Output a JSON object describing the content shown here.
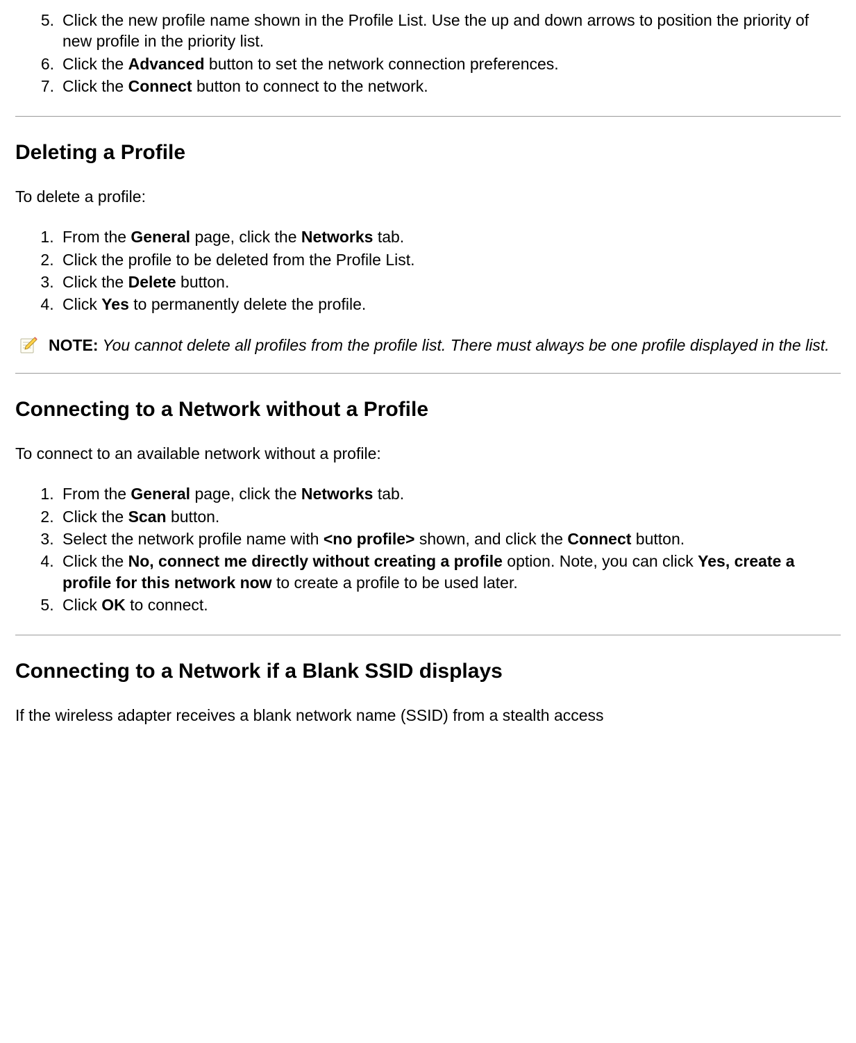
{
  "topList": {
    "items": [
      {
        "num": "5.",
        "text_a": "Click the new profile name shown in the Profile List. Use the up and down arrows to position the priority of new profile in the priority list."
      },
      {
        "num": "6.",
        "text_a": "Click the ",
        "bold_a": "Advanced",
        "text_b": " button to set the network connection preferences."
      },
      {
        "num": "7.",
        "text_a": "Click the ",
        "bold_a": "Connect",
        "text_b": " button to connect to the network."
      }
    ]
  },
  "sectionDelete": {
    "heading": "Deleting a Profile",
    "intro": "To delete a profile:",
    "items": [
      {
        "text_a": "From the ",
        "bold_a": "General",
        "text_b": " page, click the ",
        "bold_b": "Networks",
        "text_c": " tab."
      },
      {
        "text_a": "Click the profile to be deleted from the Profile List."
      },
      {
        "text_a": "Click the ",
        "bold_a": "Delete",
        "text_b": " button."
      },
      {
        "text_a": "Click ",
        "bold_a": "Yes",
        "text_b": " to permanently delete the profile."
      }
    ],
    "note_label": "NOTE:",
    "note_text": " You cannot delete all profiles from the profile list. There must always be one profile displayed in the list."
  },
  "sectionConnect": {
    "heading": "Connecting to a Network without a Profile",
    "intro": "To connect to an available network without a profile:",
    "items": [
      {
        "text_a": "From the ",
        "bold_a": "General",
        "text_b": " page, click the ",
        "bold_b": "Networks",
        "text_c": " tab."
      },
      {
        "text_a": "Click the ",
        "bold_a": "Scan",
        "text_b": " button."
      },
      {
        "text_a": "Select the network profile name with ",
        "bold_a": "<no profile>",
        "text_b": " shown, and click the ",
        "bold_b": "Connect",
        "text_c": " button."
      },
      {
        "text_a": "Click the ",
        "bold_a": "No, connect me directly without creating a profile",
        "text_b": " option. Note, you can click ",
        "bold_b": "Yes, create a profile for this network now",
        "text_c": " to create a profile to be used later."
      },
      {
        "text_a": "Click ",
        "bold_a": "OK",
        "text_b": " to connect."
      }
    ]
  },
  "sectionBlank": {
    "heading": "Connecting to a Network if a Blank SSID displays",
    "intro": "If the wireless adapter receives a blank network name (SSID) from a stealth access"
  }
}
